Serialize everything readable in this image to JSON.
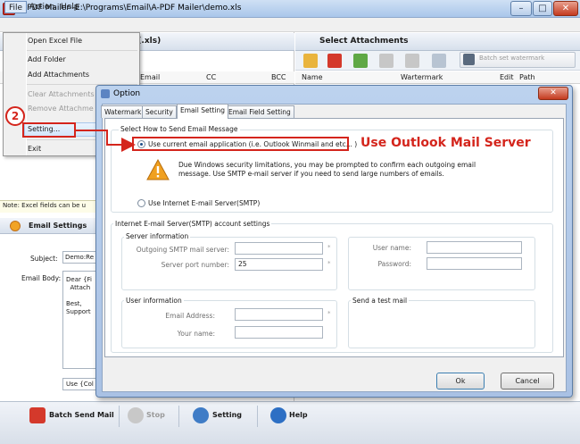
{
  "window": {
    "title": "A-PDF Mailer--E:\\Programs\\Email\\A-PDF Mailer\\demo.xls",
    "min_glyph": "–",
    "max_glyph": "□",
    "close_glyph": "✕"
  },
  "menubar": {
    "file": "File",
    "action": "Action",
    "help": "Help"
  },
  "left_panel": {
    "header_fragment": "le (.xls)",
    "columns": [
      "Email",
      "CC",
      "BCC"
    ],
    "note": "Note: Excel fields can be u",
    "email_settings_title": "Email Settings",
    "subject_label": "Subject:",
    "subject_value": "Demo:Re",
    "body_label": "Email Body:",
    "body_value": "Dear {Fi\n  Attach\n\nBest,\nSupport",
    "use_value": "Use {Col"
  },
  "right_panel": {
    "header": "Select Attachments",
    "watermark_button": "Batch set watermark",
    "columns": [
      "Name",
      "Wartermark",
      "Edit",
      "Path"
    ]
  },
  "file_menu": {
    "items": [
      {
        "label": "Open Excel File",
        "enabled": true
      },
      {
        "label": "Add Folder",
        "enabled": true
      },
      {
        "label": "Add Attachments",
        "enabled": true
      },
      {
        "label": "Clear Attachments",
        "enabled": false
      },
      {
        "label": "Remove Attachme",
        "enabled": false
      },
      {
        "label": "Setting...",
        "enabled": true
      },
      {
        "label": "Exit",
        "enabled": true
      }
    ]
  },
  "annotation": {
    "badge": "2",
    "callout": "Use Outlook Mail Server",
    "color": "#d4251c"
  },
  "dialog": {
    "title": "Option",
    "close_glyph": "✕",
    "tabs": [
      "Watermark",
      "Security",
      "Email Setting",
      "Email Field Setting"
    ],
    "active_tab": "Email Setting",
    "send_group_title": "Select How to Send Email Message",
    "option_current": "Use current email application (i.e. Outlook Winmail and etc... )",
    "warning_line1": "Due Windows security limitations,  you may be prompted to confirm each outgoing email",
    "warning_line2": "message. Use SMTP e-mail server if you need to send large numbers of emails.",
    "option_smtp": "Use Internet E-mail Server(SMTP)",
    "smtp_settings_title": "Internet E-mail Server(SMTP) account settings",
    "server_info_title": "Server information",
    "outgoing_server_label": "Outgoing SMTP mail server:",
    "outgoing_server_value": "",
    "server_port_label": "Server port number:",
    "server_port_value": "25",
    "username_label": "User name:",
    "username_value": "",
    "password_label": "Password:",
    "password_value": "",
    "user_info_title": "User information",
    "email_address_label": "Email Address:",
    "email_address_value": "",
    "your_name_label": "Your name:",
    "your_name_value": "",
    "test_mail_title": "Send a test mail",
    "star": "*",
    "ok": "Ok",
    "cancel": "Cancel"
  },
  "bottom_toolbar": {
    "batch_send": "Batch Send Mail",
    "stop": "Stop",
    "setting": "Setting",
    "help": "Help"
  }
}
